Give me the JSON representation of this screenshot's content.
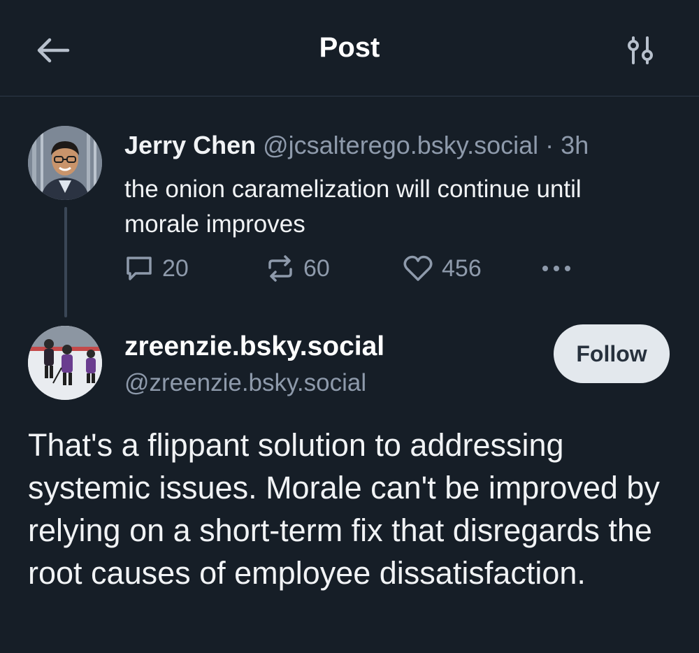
{
  "header": {
    "title": "Post"
  },
  "parent_post": {
    "author_name": "Jerry Chen",
    "author_handle": "@jcsalterego.bsky.social",
    "separator": "·",
    "time": "3h",
    "text": "the onion caramelization will continue until morale improves",
    "reply_count": "20",
    "repost_count": "60",
    "like_count": "456"
  },
  "reply_post": {
    "author_name": "zreenzie.bsky.social",
    "author_handle": "@zreenzie.bsky.social",
    "follow_label": "Follow",
    "text": "That's a flippant solution to addressing systemic issues. Morale can't be improved by relying on a short-term fix that disregards the root causes of employee dissatisfaction."
  },
  "icons": {
    "back": "arrow-left-icon",
    "settings": "sliders-icon",
    "reply": "speech-bubble-icon",
    "repost": "repost-arrows-icon",
    "like": "heart-icon",
    "more": "ellipsis-icon"
  },
  "colors": {
    "background": "#161e27",
    "text_primary": "#f1f3f5",
    "text_secondary": "#8e9aab",
    "follow_button_bg": "#e3e8ed"
  }
}
